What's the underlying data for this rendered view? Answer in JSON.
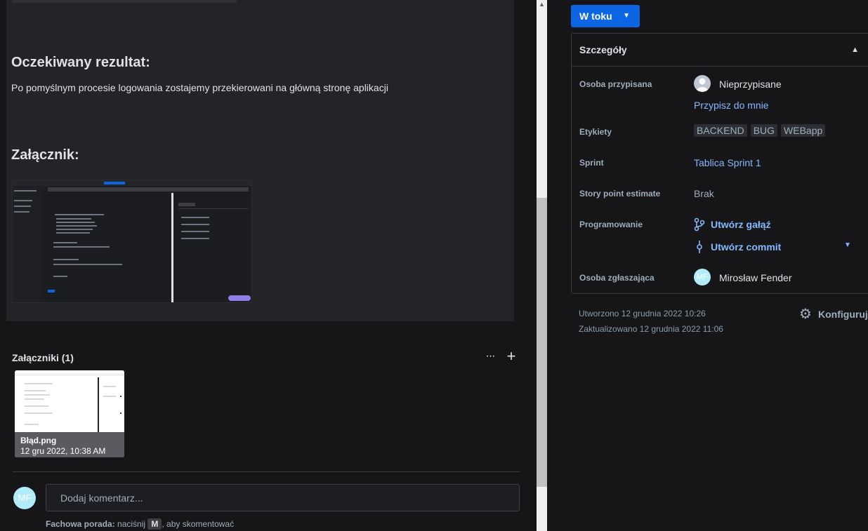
{
  "description": {
    "expected_heading": "Oczekiwany rezultat:",
    "expected_text": "Po pomyślnym procesie logowania zostajemy przekierowani na główną stronę aplikacji",
    "attachment_heading": "Załącznik:"
  },
  "attachments": {
    "header": "Załączniki (1)",
    "more_label": "···",
    "add_label": "+",
    "file": {
      "name": "Błąd.png",
      "date": "12 gru 2022, 10:38 AM"
    }
  },
  "comment": {
    "avatar_initials": "MF",
    "placeholder": "Dodaj komentarz...",
    "tip_bold": "Fachowa porada:",
    "tip_pre": " naciśnij ",
    "tip_key": "M",
    "tip_post": ", aby skomentować"
  },
  "status": {
    "label": "W toku"
  },
  "details": {
    "title": "Szczegóły",
    "assignee_label": "Osoba przypisana",
    "assignee_value": "Nieprzypisane",
    "assign_me": "Przypisz do mnie",
    "labels_label": "Etykiety",
    "labels": [
      "BACKEND",
      "BUG",
      "WEBapp"
    ],
    "sprint_label": "Sprint",
    "sprint_value": "Tablica Sprint 1",
    "story_label": "Story point estimate",
    "story_value": "Brak",
    "dev_label": "Programowanie",
    "create_branch": "Utwórz gałąź",
    "create_commit": "Utwórz commit",
    "reporter_label": "Osoba zgłaszająca",
    "reporter_initials": "MF",
    "reporter_name": "Mirosław Fender"
  },
  "meta": {
    "created": "Utworzono 12 grudnia 2022 10:26",
    "updated": "Zaktualizowano 12 grudnia 2022 11:06",
    "configure": "Konfiguruj"
  }
}
